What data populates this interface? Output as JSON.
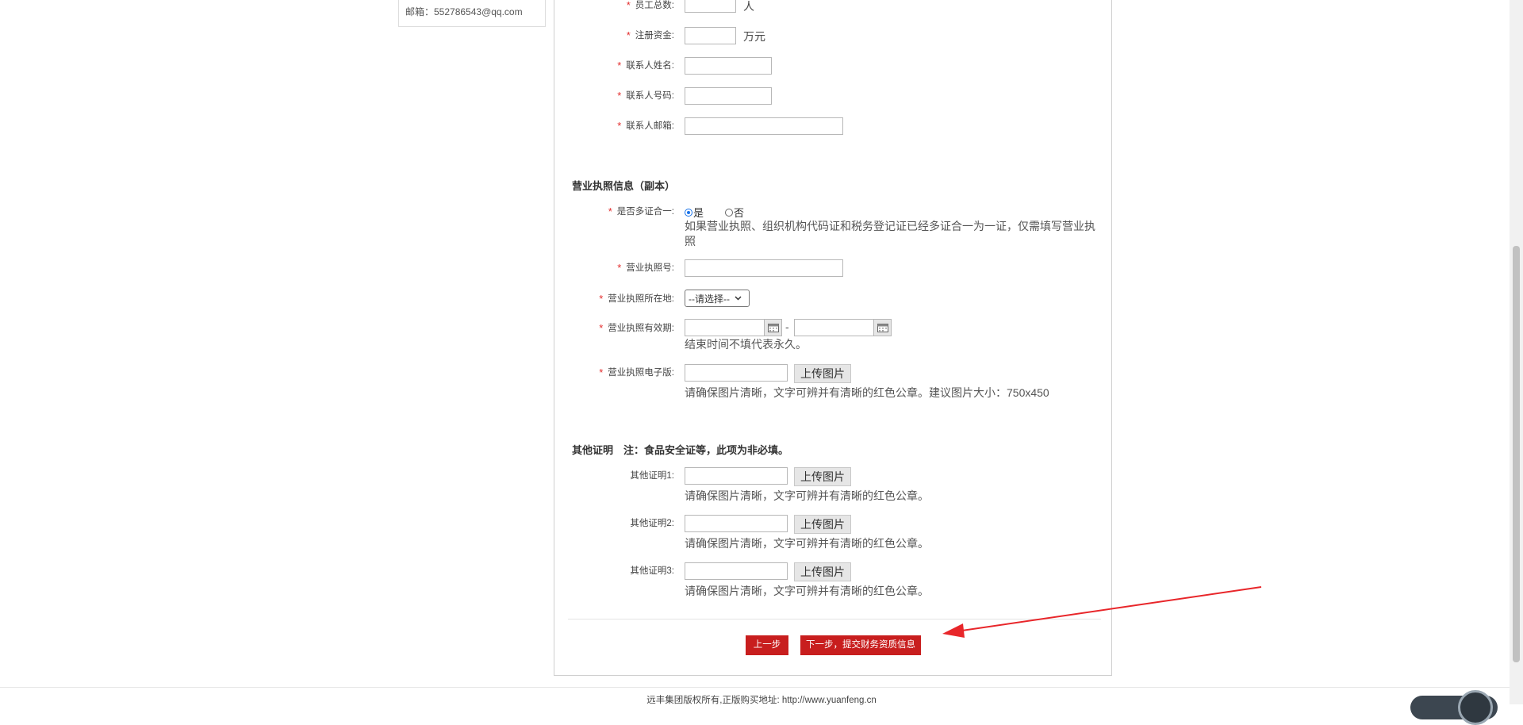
{
  "sidebar": {
    "email": "邮箱：552786543@qq.com"
  },
  "company": {
    "employees_label": "员工总数:",
    "employees_unit": "人",
    "capital_label": "注册资金:",
    "capital_unit": "万元",
    "contact_name_label": "联系人姓名:",
    "contact_phone_label": "联系人号码:",
    "contact_email_label": "联系人邮箱:"
  },
  "license": {
    "section_title": "营业执照信息（副本）",
    "multi_cert_label": "是否多证合一:",
    "radio_yes": "是",
    "radio_no": "否",
    "multi_cert_hint": "如果营业执照、组织机构代码证和税务登记证已经多证合一为一证，仅需填写营业执照",
    "number_label": "营业执照号:",
    "location_label": "营业执照所在地:",
    "location_select": "--请选择--",
    "validity_label": "营业执照有效期:",
    "validity_dash": "-",
    "validity_hint": "结束时间不填代表永久。",
    "scan_label": "营业执照电子版:",
    "upload_label": "上传图片",
    "scan_hint": "请确保图片清晰，文字可辨并有清晰的红色公章。建议图片大小：750x450"
  },
  "other": {
    "section_title": "其他证明　注：食品安全证等，此项为非必填。",
    "items": [
      {
        "label": "其他证明1:",
        "upload": "上传图片",
        "hint": "请确保图片清晰，文字可辨并有清晰的红色公章。"
      },
      {
        "label": "其他证明2:",
        "upload": "上传图片",
        "hint": "请确保图片清晰，文字可辨并有清晰的红色公章。"
      },
      {
        "label": "其他证明3:",
        "upload": "上传图片",
        "hint": "请确保图片清晰，文字可辨并有清晰的红色公章。"
      }
    ]
  },
  "actions": {
    "prev": "上一步",
    "next": "下一步，提交财务资质信息"
  },
  "footer": {
    "text": "远丰集团版权所有,正版购买地址:  http://www.yuanfeng.cn"
  },
  "colors": {
    "accent_red": "#c81e1e",
    "required_star": "#e32d2d",
    "annotation_arrow": "#e8262a"
  }
}
